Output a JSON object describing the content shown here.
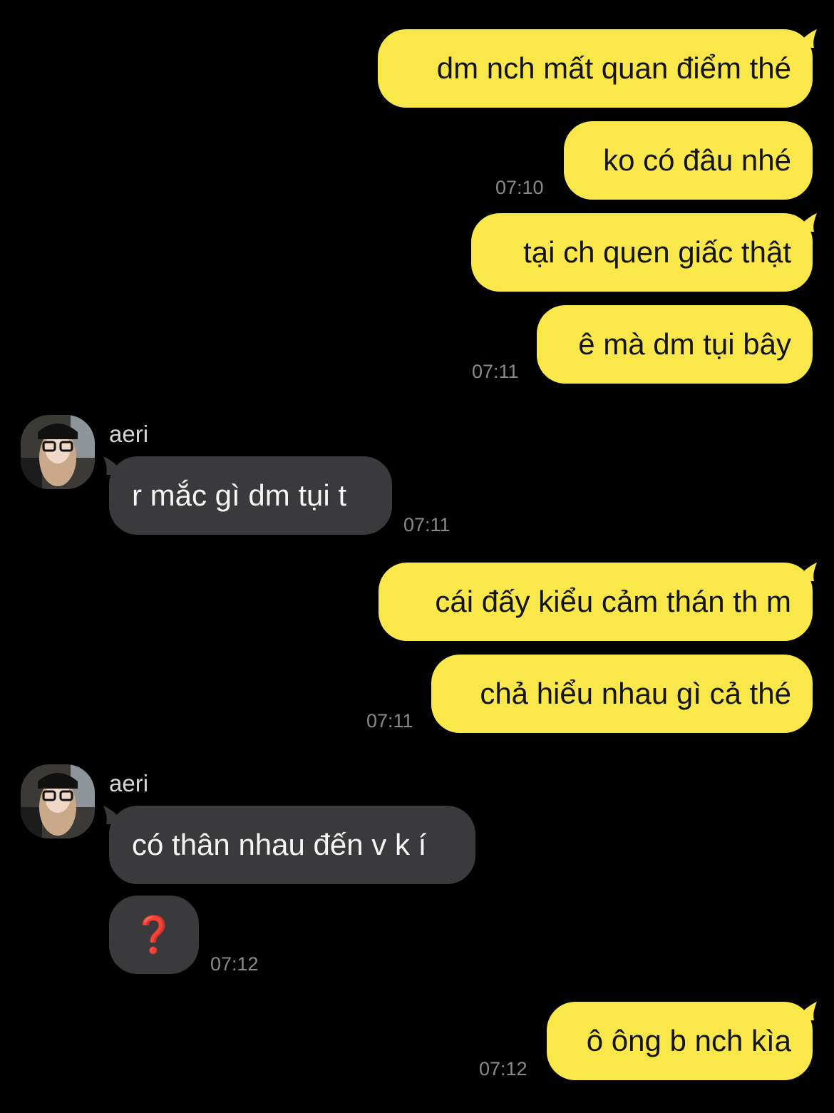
{
  "colors": {
    "background": "#000000",
    "outgoing_bubble": "#fae84a",
    "incoming_bubble": "#3a3a3c",
    "timestamp": "#8a8a8a",
    "question_mark": "#d02b20"
  },
  "messages": {
    "m1": {
      "text": "dm nch mất quan điểm thé"
    },
    "m2": {
      "text": "ko có đâu nhé",
      "time": "07:10"
    },
    "m3": {
      "text": "tại ch quen giấc thật"
    },
    "m4": {
      "text": "ê mà dm tụi bây",
      "time": "07:11"
    },
    "g1": {
      "sender": "aeri",
      "text": "r mắc gì dm tụi t",
      "time": "07:11"
    },
    "m5": {
      "text": "cái đấy kiểu cảm thán th m"
    },
    "m6": {
      "text": "chả hiểu nhau gì cả thé",
      "time": "07:11"
    },
    "g2": {
      "sender": "aeri",
      "text": "có thân nhau đến v k í"
    },
    "g3": {
      "text": "❓",
      "time": "07:12"
    },
    "m7": {
      "text": "ô ông b nch kìa",
      "time": "07:12"
    }
  }
}
